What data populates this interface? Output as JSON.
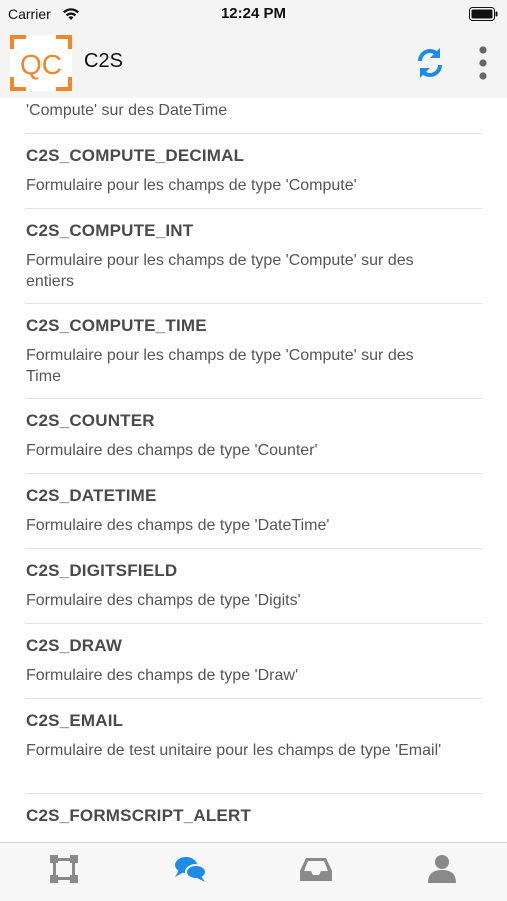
{
  "status_bar": {
    "carrier": "Carrier",
    "time": "12:24 PM"
  },
  "header": {
    "title": "C2S"
  },
  "list": {
    "partial_top_desc": "'Compute' sur des DateTime",
    "items": [
      {
        "title": "C2S_COMPUTE_DECIMAL",
        "desc": "Formulaire pour les champs de type 'Compute'"
      },
      {
        "title": "C2S_COMPUTE_INT",
        "desc": "Formulaire pour les champs de type 'Compute' sur des entiers"
      },
      {
        "title": "C2S_COMPUTE_TIME",
        "desc": "Formulaire pour les champs de type 'Compute' sur des Time"
      },
      {
        "title": "C2S_COUNTER",
        "desc": "Formulaire des champs de type 'Counter'"
      },
      {
        "title": "C2S_DATETIME",
        "desc": "Formulaire des champs de type 'DateTime'"
      },
      {
        "title": "C2S_DIGITSFIELD",
        "desc": "Formulaire des champs de type 'Digits'"
      },
      {
        "title": "C2S_DRAW",
        "desc": "Formulaire des champs de type 'Draw'"
      },
      {
        "title": "C2S_EMAIL",
        "desc": "Formulaire de test unitaire pour les champs de type 'Email'"
      },
      {
        "title": "C2S_FORMSCRIPT_ALERT",
        "desc": ""
      }
    ]
  },
  "tabs": [
    {
      "icon": "frame-icon"
    },
    {
      "icon": "chat-bubbles-icon",
      "active": true
    },
    {
      "icon": "inbox-icon"
    },
    {
      "icon": "user-icon"
    }
  ],
  "colors": {
    "accent": "#1e8be6",
    "logo": "#f0872a",
    "inactive_tab": "#8a8a8a"
  }
}
